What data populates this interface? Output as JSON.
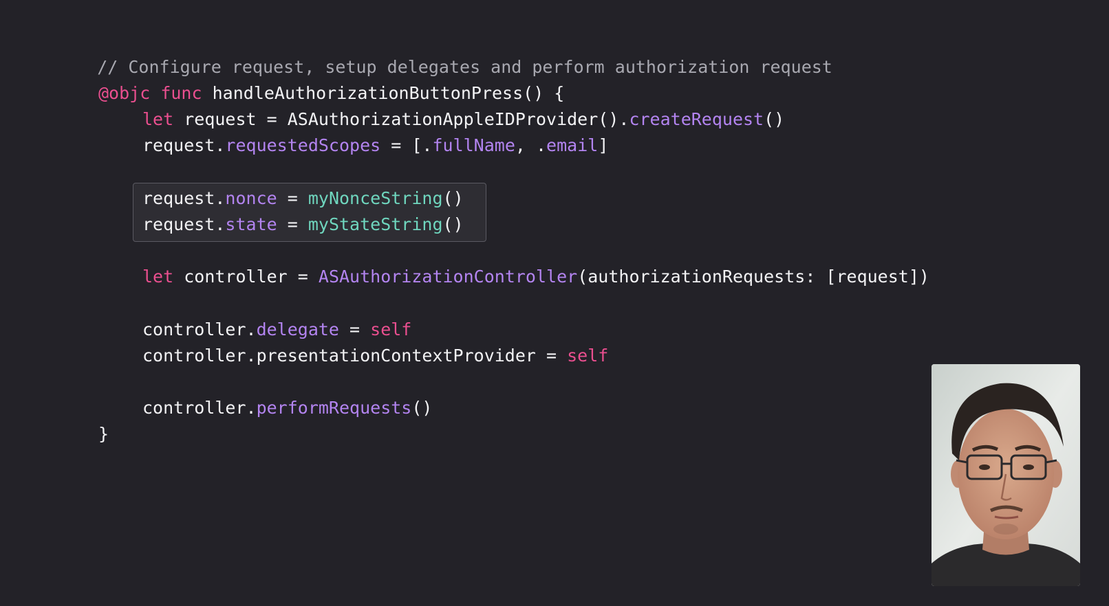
{
  "code": {
    "comment": "// Configure request, setup delegates and perform authorization request",
    "line_func": {
      "attr": "@objc",
      "kw": "func",
      "name": "handleAuthorizationButtonPress() {"
    },
    "line_let_request": {
      "kw": "let",
      "mid": "request = ASAuthorizationAppleIDProvider().",
      "call": "createRequest",
      "tail": "()"
    },
    "line_scopes": {
      "a": "request.",
      "b": "requestedScopes",
      "c": " = [.",
      "d": "fullName",
      "e": ", .",
      "f": "email",
      "g": "]"
    },
    "line_nonce": {
      "a": "request.",
      "b": "nonce",
      "c": " = ",
      "d": "myNonceString",
      "e": "()"
    },
    "line_state": {
      "a": "request.",
      "b": "state",
      "c": " = ",
      "d": "myStateString",
      "e": "()"
    },
    "line_controller": {
      "kw": "let",
      "a": "controller = ",
      "b": "ASAuthorizationController",
      "c": "(authorizationRequests: [request])"
    },
    "line_delegate": {
      "a": "controller.",
      "b": "delegate",
      "c": " = ",
      "d": "self"
    },
    "line_presentation": {
      "a": "controller.presentationContextProvider = ",
      "b": "self"
    },
    "line_perform": {
      "a": "controller.",
      "b": "performRequests",
      "c": "()"
    },
    "closing_brace": "}"
  },
  "colors": {
    "background": "#232228",
    "keyword": "#ea4f8f",
    "property": "#b384f0",
    "function": "#6fd6be",
    "comment": "#a8a8b0",
    "text": "#f2f2f4"
  },
  "presenter": {
    "icon": "presenter-video-thumbnail"
  }
}
